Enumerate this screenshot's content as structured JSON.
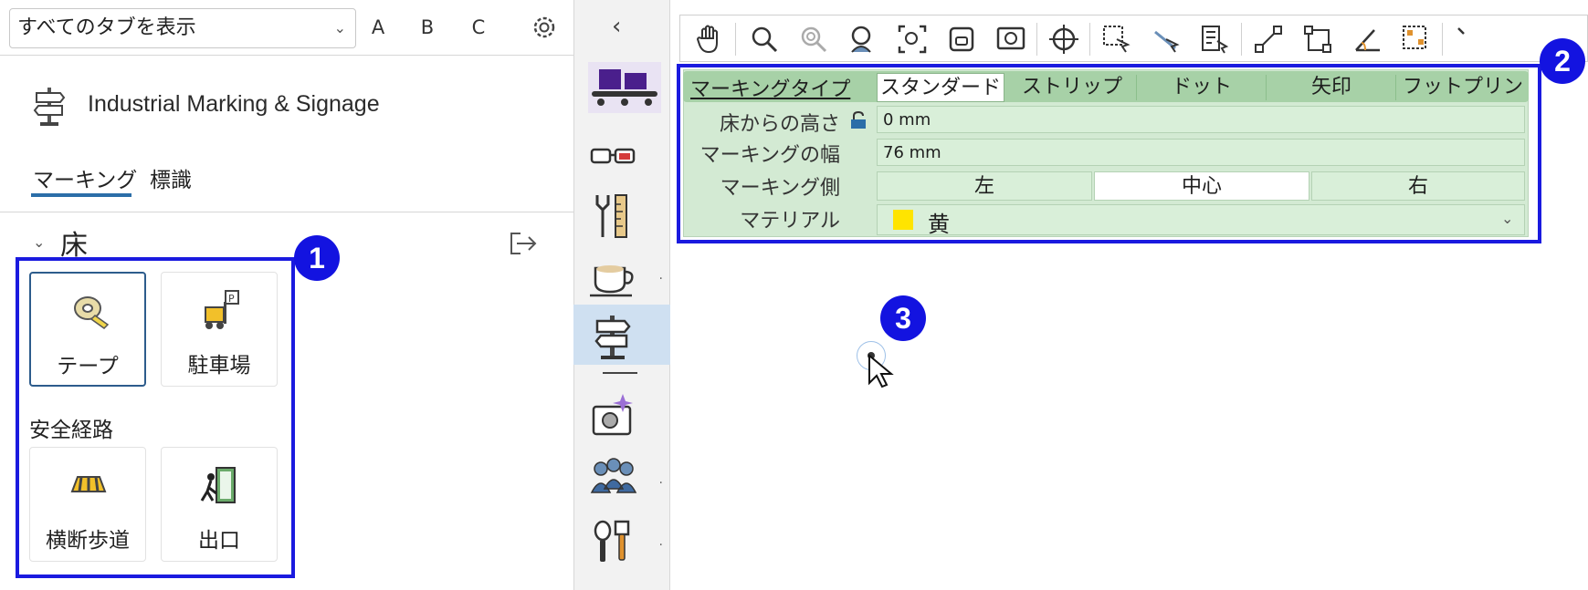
{
  "left_panel": {
    "tab_filter": {
      "selected": "すべてのタブを表示"
    },
    "letter_buttons": [
      "A",
      "B",
      "C"
    ],
    "title": "Industrial Marking & Signage",
    "subtabs": [
      "マーキング",
      "標識"
    ],
    "section": {
      "title": "床",
      "tiles_top": [
        {
          "label": "テープ",
          "icon": "tape-icon",
          "selected": true
        },
        {
          "label": "駐車場",
          "icon": "forklift-parking-icon",
          "selected": false
        }
      ],
      "group_label": "安全経路",
      "tiles_bottom": [
        {
          "label": "横断歩道",
          "icon": "crosswalk-icon",
          "selected": false
        },
        {
          "label": "出口",
          "icon": "exit-icon",
          "selected": false
        }
      ]
    }
  },
  "icon_strip": {
    "collapse_glyph": "‹",
    "items": [
      {
        "icon": "conveyor-icon"
      },
      {
        "icon": "glasses-icon"
      },
      {
        "icon": "tools-icon"
      },
      {
        "icon": "coffee-cup-icon",
        "more": "·"
      },
      {
        "icon": "signpost-icon",
        "active": true
      },
      {
        "icon": "camera-sparkle-icon"
      },
      {
        "icon": "people-icon",
        "more": "·"
      },
      {
        "icon": "kitchen-tools-icon",
        "more": "·"
      }
    ]
  },
  "toolbar": {
    "buttons": [
      "hand-pan-icon",
      "zoom-icon",
      "zoom-disabled-icon",
      "zoom-person-icon",
      "zoom-fit-icon",
      "zoom-selection-icon",
      "zoom-window-icon",
      "center-target-icon",
      "select-box-icon",
      "select-lasso-icon",
      "select-list-icon",
      "connect-points-icon",
      "distance-icon",
      "angle-icon",
      "move-points-icon",
      "more-icon"
    ]
  },
  "properties": {
    "marking_type": {
      "label": "マーキングタイプ",
      "options": [
        "スタンダード",
        "ストリップ",
        "ドット",
        "矢印",
        "フットプリント"
      ],
      "selected": "スタンダード"
    },
    "height": {
      "label": "床からの高さ",
      "value": "0 mm"
    },
    "width": {
      "label": "マーキングの幅",
      "value": "76 mm"
    },
    "side": {
      "label": "マーキング側",
      "options": [
        "左",
        "中心",
        "右"
      ],
      "selected": "中心"
    },
    "material": {
      "label": "マテリアル",
      "value": "黄",
      "swatch_color": "#ffe400"
    }
  },
  "badges": [
    "1",
    "2",
    "3"
  ],
  "colors": {
    "callout": "#1a1adf",
    "accent": "#2b6ea8",
    "panel_green": "#d3ead3"
  }
}
